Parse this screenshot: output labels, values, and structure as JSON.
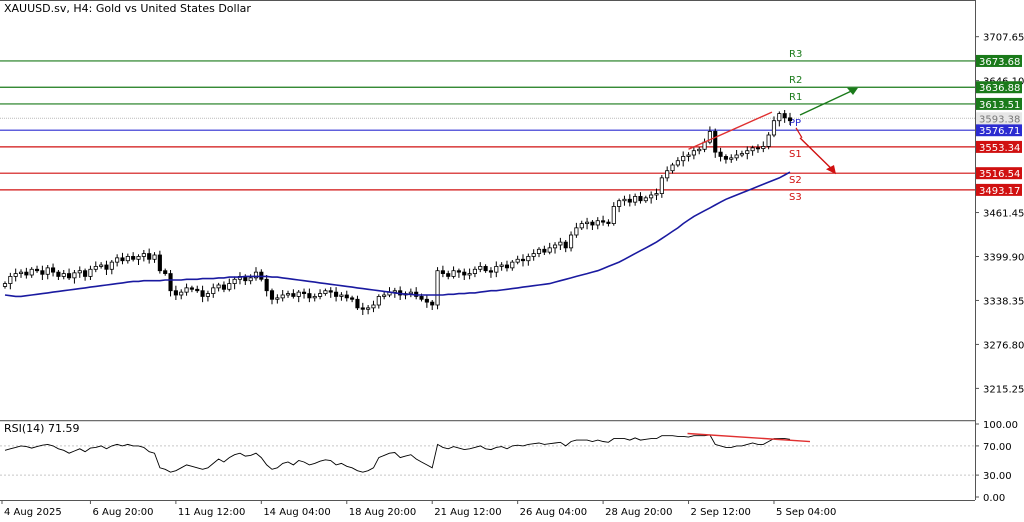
{
  "header": {
    "symbol_title": "XAUUSD.sv, H4:  Gold vs United States Dollar"
  },
  "colors": {
    "bull": "#ffffff",
    "bear": "#000000",
    "ma": "#1a1aa0",
    "resistance": "#1a7a1a",
    "pivot": "#2b2bd0",
    "support": "#d01010",
    "current_price": "#bbbbbb",
    "rsi": "#000000",
    "divergence": "#e03030"
  },
  "chart_data": [
    {
      "type": "candlestick",
      "title": "XAUUSD.sv, H4:  Gold vs United States Dollar",
      "ylim": [
        3185,
        3745
      ],
      "y_ticks": [
        3707.65,
        3646.1,
        3584.55,
        3523.0,
        3461.45,
        3399.9,
        3338.35,
        3276.8,
        3215.25
      ],
      "y_tick_labels": [
        "3707.65",
        "3646.10",
        "",
        "",
        "3461.45",
        "3399.90",
        "3338.35",
        "3276.80",
        "3215.25"
      ],
      "x_tick_labels": [
        "4 Aug 2025",
        "6 Aug 20:00",
        "11 Aug 12:00",
        "14 Aug 04:00",
        "18 Aug 20:00",
        "21 Aug 12:00",
        "26 Aug 04:00",
        "28 Aug 20:00",
        "2 Sep 12:00",
        "5 Sep 04:00"
      ],
      "x_tick_index": [
        0,
        16,
        32,
        48,
        64,
        80,
        96,
        112,
        128,
        144
      ],
      "current_price": 3593.38,
      "pivot_levels": [
        {
          "name": "R3",
          "value": 3673.68,
          "group": "resistance"
        },
        {
          "name": "R2",
          "value": 3636.88,
          "group": "resistance"
        },
        {
          "name": "R1",
          "value": 3613.51,
          "group": "resistance"
        },
        {
          "name": "PP",
          "value": 3576.71,
          "group": "pivot"
        },
        {
          "name": "S1",
          "value": 3553.34,
          "group": "support"
        },
        {
          "name": "S2",
          "value": 3516.54,
          "group": "support"
        },
        {
          "name": "S3",
          "value": 3493.17,
          "group": "support"
        }
      ],
      "close": [
        3362,
        3372,
        3376,
        3378,
        3374,
        3382,
        3380,
        3375,
        3384,
        3378,
        3372,
        3376,
        3370,
        3377,
        3380,
        3372,
        3382,
        3386,
        3388,
        3382,
        3392,
        3398,
        3394,
        3400,
        3396,
        3400,
        3404,
        3396,
        3402,
        3380,
        3376,
        3352,
        3346,
        3350,
        3356,
        3354,
        3352,
        3344,
        3348,
        3356,
        3360,
        3354,
        3362,
        3368,
        3372,
        3366,
        3370,
        3378,
        3368,
        3352,
        3340,
        3342,
        3346,
        3348,
        3344,
        3350,
        3348,
        3342,
        3344,
        3348,
        3352,
        3350,
        3344,
        3346,
        3342,
        3340,
        3328,
        3326,
        3328,
        3332,
        3344,
        3346,
        3350,
        3352,
        3346,
        3348,
        3350,
        3344,
        3340,
        3336,
        3332,
        3380,
        3376,
        3372,
        3380,
        3378,
        3374,
        3376,
        3382,
        3386,
        3380,
        3378,
        3386,
        3388,
        3384,
        3392,
        3396,
        3394,
        3400,
        3404,
        3410,
        3406,
        3412,
        3416,
        3420,
        3412,
        3430,
        3440,
        3446,
        3448,
        3444,
        3450,
        3448,
        3446,
        3470,
        3478,
        3480,
        3476,
        3484,
        3478,
        3482,
        3486,
        3488,
        3510,
        3520,
        3528,
        3534,
        3540,
        3542,
        3548,
        3550,
        3560,
        3575,
        3546,
        3540,
        3536,
        3538,
        3542,
        3544,
        3548,
        3552,
        3551,
        3554,
        3570,
        3590,
        3600,
        3594,
        3590
      ],
      "ma_period_label": "",
      "ma": [
        3346,
        3345,
        3344,
        3344,
        3345,
        3346,
        3347,
        3348,
        3349,
        3350,
        3351,
        3352,
        3353,
        3354,
        3355,
        3356,
        3357,
        3358,
        3359,
        3360,
        3361,
        3362,
        3363,
        3364,
        3365,
        3365,
        3366,
        3366,
        3366,
        3366,
        3367,
        3367,
        3367,
        3367,
        3368,
        3368,
        3368,
        3369,
        3369,
        3369,
        3370,
        3370,
        3371,
        3371,
        3371,
        3372,
        3372,
        3372,
        3372,
        3372,
        3371,
        3371,
        3370,
        3369,
        3368,
        3367,
        3366,
        3365,
        3364,
        3363,
        3362,
        3361,
        3360,
        3359,
        3358,
        3357,
        3356,
        3355,
        3354,
        3353,
        3352,
        3351,
        3350,
        3349,
        3348,
        3347,
        3347,
        3346,
        3346,
        3346,
        3346,
        3346,
        3346,
        3347,
        3347,
        3348,
        3348,
        3349,
        3349,
        3350,
        3351,
        3352,
        3352,
        3353,
        3354,
        3355,
        3356,
        3357,
        3358,
        3359,
        3360,
        3361,
        3362,
        3364,
        3366,
        3368,
        3370,
        3372,
        3374,
        3376,
        3378,
        3380,
        3383,
        3386,
        3389,
        3392,
        3396,
        3400,
        3404,
        3408,
        3412,
        3416,
        3420,
        3425,
        3430,
        3435,
        3440,
        3446,
        3451,
        3456,
        3460,
        3464,
        3468,
        3472,
        3476,
        3480,
        3483,
        3486,
        3489,
        3492,
        3495,
        3498,
        3501,
        3504,
        3507,
        3510,
        3514,
        3518
      ]
    },
    {
      "type": "line",
      "title": "RSI(14) 71.59",
      "ylim": [
        0,
        100
      ],
      "y_ticks": [
        100,
        70,
        30,
        0
      ],
      "y_tick_labels": [
        "100.00",
        "70.00",
        "30.00",
        "0.00"
      ],
      "values": [
        64,
        66,
        68,
        70,
        69,
        67,
        69,
        71,
        72,
        70,
        66,
        64,
        60,
        63,
        66,
        62,
        67,
        68,
        70,
        66,
        70,
        72,
        70,
        72,
        70,
        70,
        68,
        62,
        60,
        40,
        38,
        34,
        36,
        40,
        44,
        42,
        40,
        38,
        40,
        46,
        52,
        48,
        54,
        58,
        60,
        56,
        57,
        60,
        54,
        44,
        38,
        40,
        46,
        48,
        44,
        50,
        48,
        44,
        46,
        49,
        51,
        50,
        44,
        46,
        42,
        40,
        36,
        34,
        36,
        40,
        54,
        57,
        60,
        61,
        54,
        56,
        58,
        52,
        48,
        44,
        40,
        72,
        68,
        66,
        69,
        67,
        65,
        66,
        68,
        70,
        66,
        65,
        68,
        69,
        66,
        70,
        71,
        70,
        72,
        73,
        74,
        72,
        73,
        74,
        75,
        70,
        76,
        78,
        78,
        78,
        76,
        78,
        76,
        75,
        80,
        80,
        80,
        78,
        81,
        78,
        79,
        80,
        80,
        84,
        84,
        84,
        83,
        83,
        82,
        84,
        84,
        84,
        85,
        72,
        70,
        68,
        68,
        70,
        70,
        72,
        74,
        72,
        72,
        76,
        80,
        80,
        80,
        79
      ]
    }
  ]
}
